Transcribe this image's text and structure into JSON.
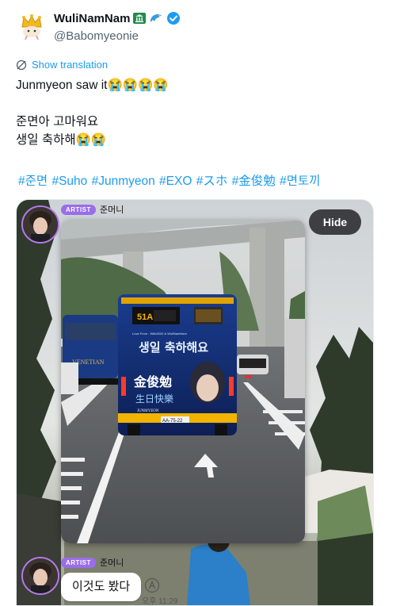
{
  "author": {
    "display_name": "WuliNamNam",
    "handle": "@Babomyeonie",
    "name_icons": [
      "crown-avatar-icon",
      "bank-flag-icon",
      "dolphin-icon",
      "verified-badge-icon"
    ]
  },
  "tweet": {
    "translate_label": "Show translation",
    "text_line1": "Junmyeon saw it😭😭😭😭",
    "text_line2": "준면아 고마워요",
    "text_line3": "생일 축하해😭😭",
    "hashtags": [
      "#준면",
      "#Suho",
      "#Junmyeon",
      "#EXO",
      "#スホ",
      "#金俊勉",
      "#면토끼"
    ]
  },
  "media": {
    "hide_label": "Hide",
    "top_message": {
      "badge": "ARTIST",
      "sender": "준머니"
    },
    "story_image": {
      "bus_banner": "생일 축하해요",
      "bus_name_cn": "金俊勉",
      "bus_sub_cn": "生日快樂",
      "bus_name_en": "JUNMYEON",
      "bus_route": "51A",
      "bus_plate": "AA-75-22",
      "bus_from": "Love From : With2020 & WuliNamNam",
      "side_bus_text": "VENETIAN"
    },
    "bottom_message": {
      "badge": "ARTIST",
      "sender": "준머니",
      "text": "이것도 봤다",
      "time": "오후 11:29"
    }
  },
  "colors": {
    "link": "#1d9bf0",
    "artist_badge": "#9a6dea",
    "hide_button": "#3d3f42"
  }
}
